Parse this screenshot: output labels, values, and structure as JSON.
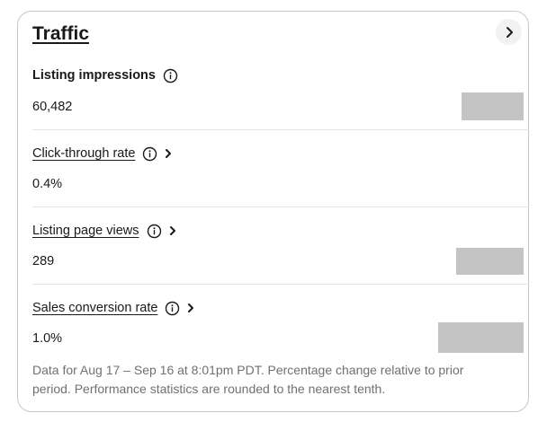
{
  "card": {
    "title": "Traffic",
    "nav_icon": "chevron-right-icon"
  },
  "metrics": [
    {
      "label": "Listing impressions",
      "value": "60,482",
      "info_icon": "info-icon"
    },
    {
      "label": "Click-through rate",
      "value": "0.4%",
      "info_icon": "info-icon",
      "chevron_icon": "chevron-right-icon"
    },
    {
      "label": "Listing page views",
      "value": "289",
      "info_icon": "info-icon",
      "chevron_icon": "chevron-right-icon"
    },
    {
      "label": "Sales conversion rate",
      "value": "1.0%",
      "info_icon": "info-icon",
      "chevron_icon": "chevron-right-icon"
    }
  ],
  "footnote": "Data for Aug 17 – Sep 16 at 8:01pm PDT. Percentage change relative to prior period. Performance statistics are rounded to the nearest tenth.",
  "colors": {
    "text": "#191919",
    "muted": "#707070",
    "border": "#c7c7c7",
    "placeholder": "#c4c4c4"
  }
}
